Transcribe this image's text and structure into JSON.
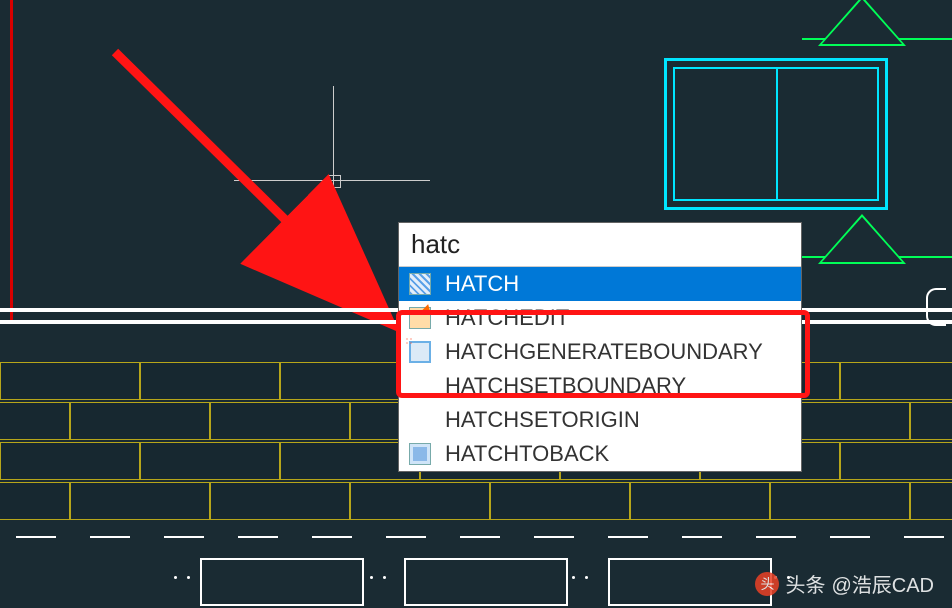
{
  "command_input": "hatc",
  "suggestions": [
    {
      "label": "HATCH",
      "icon": "hatch",
      "selected": true
    },
    {
      "label": "HATCHEDIT",
      "icon": "edit",
      "selected": false
    },
    {
      "label": "HATCHGENERATEBOUNDARY",
      "icon": "gen",
      "selected": false,
      "highlighted": true
    },
    {
      "label": "HATCHSETBOUNDARY",
      "icon": "none",
      "selected": false
    },
    {
      "label": "HATCHSETORIGIN",
      "icon": "none",
      "selected": false
    },
    {
      "label": "HATCHTOBACK",
      "icon": "back",
      "selected": false
    }
  ],
  "watermark": {
    "prefix": "头条",
    "handle": "@浩辰CAD"
  }
}
